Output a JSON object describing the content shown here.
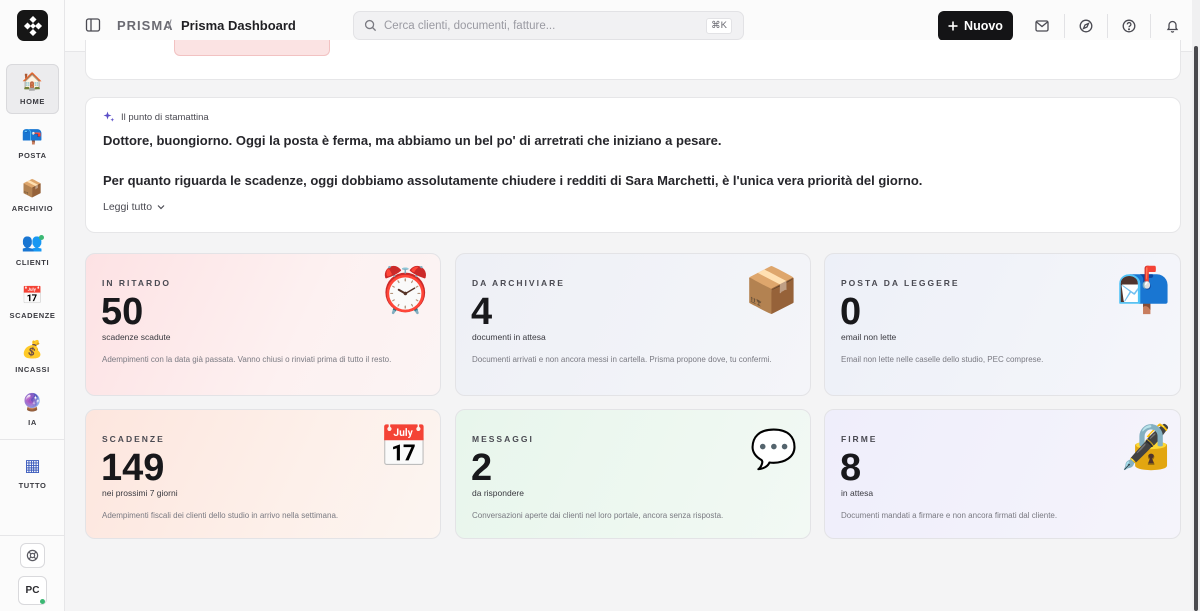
{
  "topbar": {
    "brand": "PRISMA",
    "separator": "/",
    "page_title": "Prisma Dashboard",
    "search_placeholder": "Cerca clienti, documenti, fatture...",
    "search_shortcut": "⌘K",
    "new_button": "Nuovo"
  },
  "sidebar": {
    "items": [
      {
        "label": "HOME",
        "icon": "house-icon",
        "glyph": "🏠"
      },
      {
        "label": "POSTA",
        "icon": "mailbox-icon",
        "glyph": "📪"
      },
      {
        "label": "ARCHIVIO",
        "icon": "archive-box-icon",
        "glyph": "📦"
      },
      {
        "label": "CLIENTI",
        "icon": "people-icon",
        "glyph": "👥"
      },
      {
        "label": "SCADENZE",
        "icon": "calendar-icon",
        "glyph": "📅"
      },
      {
        "label": "INCASSI",
        "icon": "money-bag-icon",
        "glyph": "💰"
      },
      {
        "label": "IA",
        "icon": "crystal-ball-icon",
        "glyph": "🔮"
      },
      {
        "label": "TUTTO",
        "icon": "grid-icon",
        "glyph": "▦"
      }
    ],
    "avatar": "PC"
  },
  "briefing": {
    "heading": "Il punto di stamattina",
    "line1": "Dottore, buongiorno. Oggi la posta è ferma, ma abbiamo un bel po' di arretrati che iniziano a pesare.",
    "line2": "Per quanto riguarda le scadenze, oggi dobbiamo assolutamente chiudere i redditi di Sara Marchetti, è l'unica vera priorità del giorno.",
    "read_more": "Leggi tutto"
  },
  "stats": [
    {
      "eyebrow": "IN RITARDO",
      "value": "50",
      "unit": "scadenze scadute",
      "desc": "Adempimenti con la data già passata. Vanno chiusi o rinviati prima di tutto il resto.",
      "icon": "alarm-clock-icon",
      "glyph": "⏰"
    },
    {
      "eyebrow": "DA ARCHIVIARE",
      "value": "4",
      "unit": "documenti in attesa",
      "desc": "Documenti arrivati e non ancora messi in cartella. Prisma propone dove, tu confermi.",
      "icon": "cardboard-box-icon",
      "glyph": "📦"
    },
    {
      "eyebrow": "POSTA DA LEGGERE",
      "value": "0",
      "unit": "email non lette",
      "desc": "Email non lette nelle caselle dello studio, PEC comprese.",
      "icon": "mailbox-icon",
      "glyph": "📬"
    },
    {
      "eyebrow": "SCADENZE",
      "value": "149",
      "unit": "nei prossimi 7 giorni",
      "desc": "Adempimenti fiscali dei clienti dello studio in arrivo nella settimana.",
      "icon": "calendar-icon",
      "glyph": "📅"
    },
    {
      "eyebrow": "MESSAGGI",
      "value": "2",
      "unit": "da rispondere",
      "desc": "Conversazioni aperte dai clienti nel loro portale, ancora senza risposta.",
      "icon": "speech-bubble-icon",
      "glyph": "💬"
    },
    {
      "eyebrow": "FIRME",
      "value": "8",
      "unit": "in attesa",
      "desc": "Documenti mandati a firmare e non ancora firmati dal cliente.",
      "icon": "wax-seal-icon",
      "glyph": "🔏"
    }
  ]
}
